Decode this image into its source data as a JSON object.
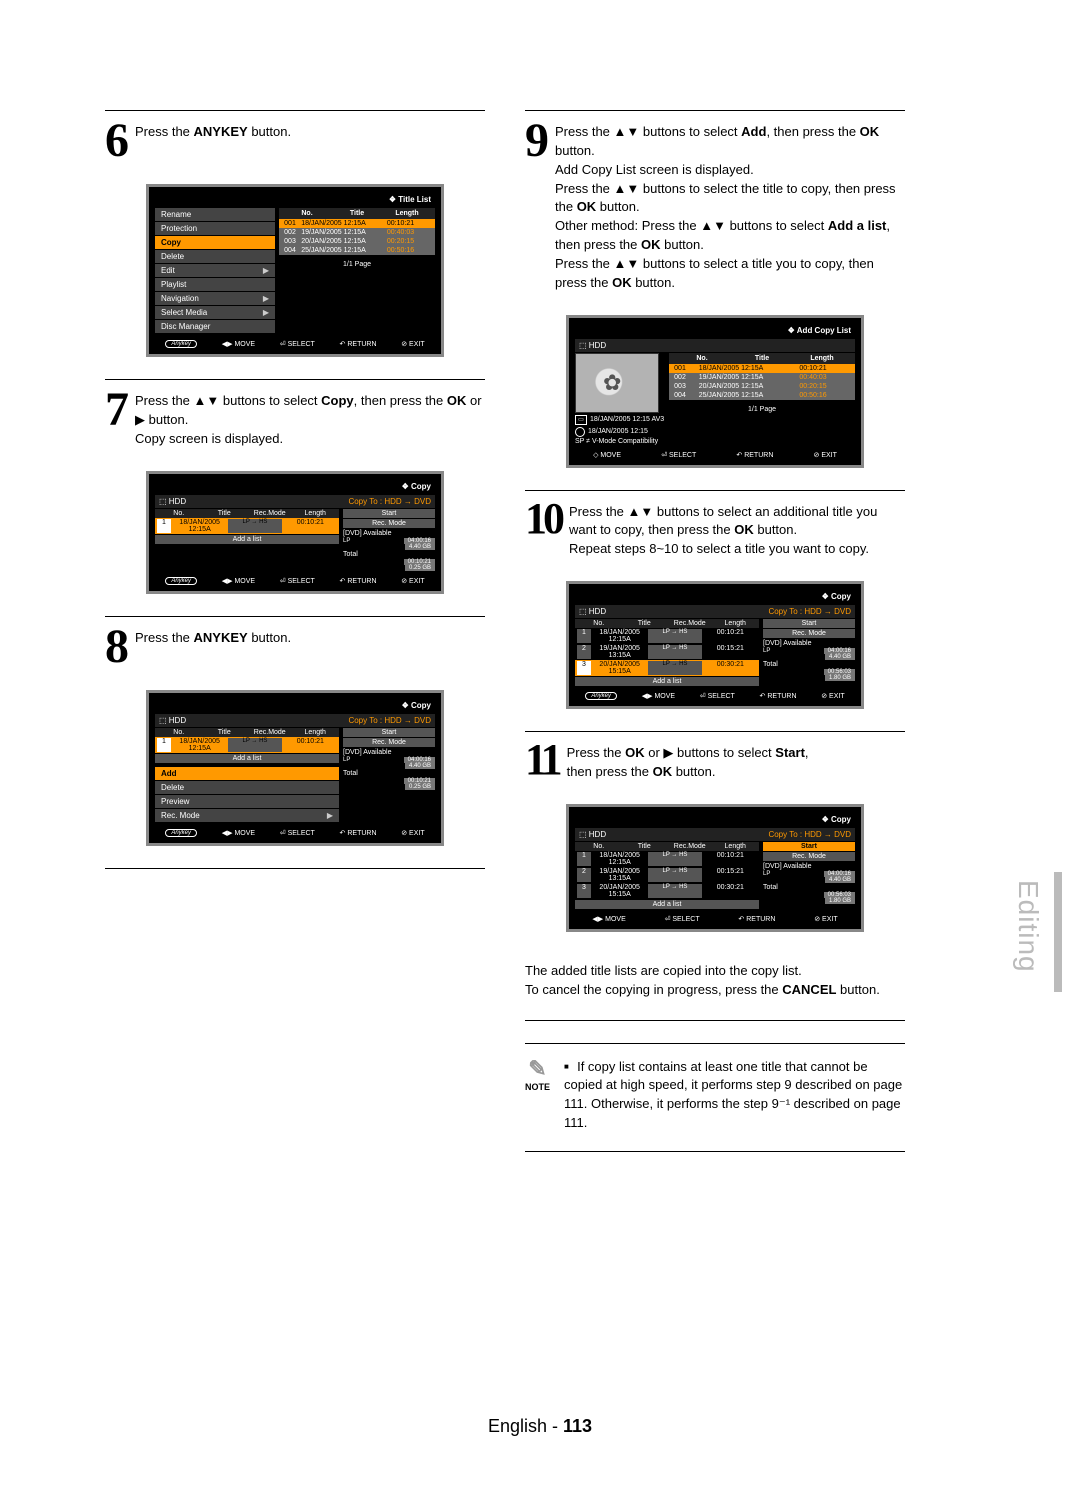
{
  "side_tab": "Editing",
  "footer": {
    "lang": "English -",
    "page": "113"
  },
  "step6": {
    "num": "6",
    "textA": "Press the ",
    "bold1": "ANYKEY",
    "textB": " button."
  },
  "card6": {
    "title": "Title List",
    "menu": {
      "rename": "Rename",
      "protection": "Protection",
      "copy": "Copy",
      "delete": "Delete",
      "edit": "Edit",
      "playlist": "Playlist",
      "navigation": "Navigation",
      "selectmedia": "Select Media",
      "discmgr": "Disc Manager"
    },
    "head": {
      "no": "No.",
      "title": "Title",
      "len": "Length"
    },
    "rows": [
      {
        "no": "001",
        "title": "18/JAN/2005 12:15A",
        "len": "00:10:21"
      },
      {
        "no": "002",
        "title": "19/JAN/2005 12:15A",
        "len": "00:40:03"
      },
      {
        "no": "003",
        "title": "20/JAN/2005 12:15A",
        "len": "00:20:15"
      },
      {
        "no": "004",
        "title": "25/JAN/2005 12:15A",
        "len": "00:50:16"
      }
    ],
    "pageinfo": "1/1 Page",
    "footer": [
      "MOVE",
      "SELECT",
      "RETURN",
      "EXIT"
    ],
    "anykey": "Anykey"
  },
  "step7": {
    "num": "7",
    "t1": "Press the ▲▼ buttons to select ",
    "b1": "Copy",
    "t2": ", then press the ",
    "b2": "OK",
    "t3": " or ▶ button.",
    "t4": "Copy screen is displayed."
  },
  "card7": {
    "title": "Copy",
    "hdd": "HDD",
    "copyto": "Copy To : HDD → DVD",
    "head": {
      "no": "No.",
      "title": "Title",
      "rec": "Rec.Mode",
      "len": "Length"
    },
    "row1": {
      "no": "1",
      "title": "18/JAN/2005 12:15A",
      "rec": "LP → HS",
      "len": "00:10:21"
    },
    "addlist": "Add a list",
    "side": {
      "start": "Start",
      "recmode": "Rec. Mode",
      "dvdavail": "[DVD] Available",
      "lp": "LP",
      "lpv": "04:00:16",
      "lpv2": "4.40 GB",
      "total": "Total",
      "tot1": "00:10:21",
      "tot2": "0.25 GB"
    },
    "footer": [
      "MOVE",
      "SELECT",
      "RETURN",
      "EXIT"
    ],
    "anykey": "Anykey"
  },
  "step8": {
    "num": "8",
    "textA": "Press the ",
    "bold1": "ANYKEY",
    "textB": " button."
  },
  "card8": {
    "title": "Copy",
    "hdd": "HDD",
    "copyto": "Copy To : HDD → DVD",
    "head": {
      "no": "No.",
      "title": "Title",
      "rec": "Rec.Mode",
      "len": "Length"
    },
    "row1": {
      "no": "1",
      "title": "18/JAN/2005 12:15A",
      "rec": "LP → HS",
      "len": "00:10:21"
    },
    "addlist": "Add a list",
    "menu": {
      "add": "Add",
      "delete": "Delete",
      "preview": "Preview",
      "recmode": "Rec. Mode"
    },
    "side": {
      "start": "Start",
      "recmode": "Rec. Mode",
      "dvdavail": "[DVD] Available",
      "lp": "LP",
      "lpv": "04:00:16",
      "lpv2": "4.40 GB",
      "total": "Total",
      "tot1": "00:10:21",
      "tot2": "0.25 GB"
    },
    "footer": [
      "MOVE",
      "SELECT",
      "RETURN",
      "EXIT"
    ],
    "anykey": "Anykey"
  },
  "step9": {
    "num": "9",
    "t1": "Press the ▲▼ buttons to select ",
    "b1": "Add",
    "t2": ", then press the ",
    "b2": "OK",
    "t3": " button.",
    "t4": "Add Copy List screen is displayed.",
    "t5": "Press the ▲▼ buttons to select the title to copy, then press the ",
    "b3": "OK",
    "t6": " button.",
    "t7": "Other method: Press the ▲▼ buttons to select ",
    "b4": "Add a list",
    "t8": ", then press the ",
    "b5": "OK",
    "t9": " button.",
    "t10": "Press the ▲▼ buttons to select a title you to copy, then press the ",
    "b6": "OK",
    "t11": " button."
  },
  "card9": {
    "title": "Add Copy List",
    "hdd": "HDD",
    "head": {
      "no": "No.",
      "title": "Title",
      "len": "Length"
    },
    "rows": [
      {
        "no": "001",
        "title": "18/JAN/2005 12:15A",
        "len": "00:10:21"
      },
      {
        "no": "002",
        "title": "19/JAN/2005 12:15A",
        "len": "00:40:03"
      },
      {
        "no": "003",
        "title": "20/JAN/2005 12:15A",
        "len": "00:20:15"
      },
      {
        "no": "004",
        "title": "25/JAN/2005 12:15A",
        "len": "00:50:16"
      }
    ],
    "meta1": "18/JAN/2005 12:15 AV3",
    "meta2": "18/JAN/2005 12:15",
    "meta3": "SP ≠ V-Mode Compatibility",
    "pageinfo": "1/1 Page",
    "footer": [
      "MOVE",
      "SELECT",
      "RETURN",
      "EXIT"
    ]
  },
  "step10": {
    "num": "10",
    "t1": "Press the ▲▼ buttons to select an additional title you want to copy, then press the ",
    "b1": "OK",
    "t2": " button.",
    "t3": "Repeat steps 8~10 to select a title you want to copy."
  },
  "card10": {
    "title": "Copy",
    "hdd": "HDD",
    "copyto": "Copy To : HDD → DVD",
    "head": {
      "no": "No.",
      "title": "Title",
      "rec": "Rec.Mode",
      "len": "Length"
    },
    "rows": [
      {
        "no": "1",
        "title": "18/JAN/2005 12:15A",
        "rec": "LP → HS",
        "len": "00:10:21"
      },
      {
        "no": "2",
        "title": "19/JAN/2005 13:15A",
        "rec": "LP → HS",
        "len": "00:15:21"
      },
      {
        "no": "3",
        "title": "20/JAN/2005 15:15A",
        "rec": "LP → HS",
        "len": "00:30:21"
      }
    ],
    "addlist": "Add a list",
    "side": {
      "start": "Start",
      "recmode": "Rec. Mode",
      "dvdavail": "[DVD] Available",
      "lp": "LP",
      "lpv": "04:00:16",
      "lpv2": "4.40 GB",
      "total": "Total",
      "tot1": "00:56:03",
      "tot2": "1.80 GB"
    },
    "footer": [
      "MOVE",
      "SELECT",
      "RETURN",
      "EXIT"
    ],
    "anykey": "Anykey"
  },
  "step11": {
    "num": "11",
    "t1": "Press the ",
    "b1": "OK",
    "t2": " or ▶ buttons to select ",
    "b2": "Start",
    "t3": ",",
    "t4": "then press the ",
    "b3": "OK",
    "t5": " button."
  },
  "card11": {
    "title": "Copy",
    "hdd": "HDD",
    "copyto": "Copy To : HDD → DVD",
    "head": {
      "no": "No.",
      "title": "Title",
      "rec": "Rec.Mode",
      "len": "Length"
    },
    "rows": [
      {
        "no": "1",
        "title": "18/JAN/2005 12:15A",
        "rec": "LP → HS",
        "len": "00:10:21"
      },
      {
        "no": "2",
        "title": "19/JAN/2005 13:15A",
        "rec": "LP → HS",
        "len": "00:15:21"
      },
      {
        "no": "3",
        "title": "20/JAN/2005 15:15A",
        "rec": "LP → HS",
        "len": "00:30:21"
      }
    ],
    "addlist": "Add a list",
    "side": {
      "start": "Start",
      "recmode": "Rec. Mode",
      "dvdavail": "[DVD] Available",
      "lp": "LP",
      "lpv": "04:00:16",
      "lpv2": "4.40 GB",
      "total": "Total",
      "tot1": "00:56:03",
      "tot2": "1.80 GB"
    },
    "footer": [
      "MOVE",
      "SELECT",
      "RETURN",
      "EXIT"
    ]
  },
  "post11": {
    "t1": "The added title lists are copied into the copy list.",
    "t2a": "To cancel the copying in progress, press the ",
    "b1": "CANCEL",
    "t2b": " button."
  },
  "note": {
    "label": "NOTE",
    "text": "If copy list contains at least one title that cannot be copied at high speed, it performs step 9 described on page 111. Otherwise, it performs the step 9⁻¹ described on page 111."
  }
}
